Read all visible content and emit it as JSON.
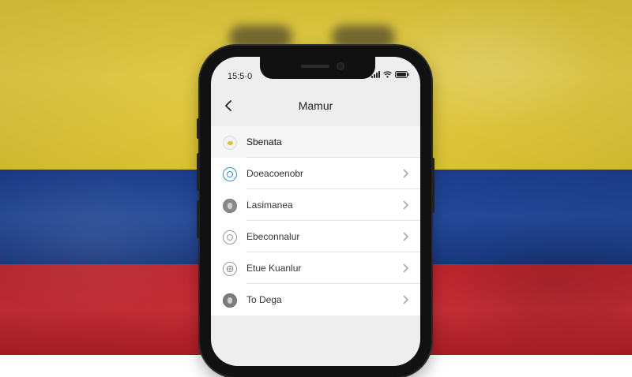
{
  "colors": {
    "flag_yellow": "#efd64a",
    "flag_blue": "#254c9f",
    "flag_red": "#d23039",
    "screen_bg": "#eeeeee"
  },
  "status_bar": {
    "time": "15:5·0",
    "icons": [
      "signal-icon",
      "wifi-icon",
      "battery-icon"
    ]
  },
  "nav": {
    "title": "Mamur",
    "back_icon": "chevron-left-icon"
  },
  "menu": [
    {
      "label": "Sbenata",
      "icon": "yellow-dot-icon",
      "has_chevron": false
    },
    {
      "label": "Doeacoenobr",
      "icon": "blue-circle-icon",
      "has_chevron": true
    },
    {
      "label": "Lasimanea",
      "icon": "gray-person-icon",
      "has_chevron": true
    },
    {
      "label": "Ebeconnalur",
      "icon": "gray-circle-icon",
      "has_chevron": true
    },
    {
      "label": "Etue Kuanlur",
      "icon": "gray-globe-icon",
      "has_chevron": true
    },
    {
      "label": "To Dega",
      "icon": "gray-person-icon",
      "has_chevron": true
    }
  ]
}
